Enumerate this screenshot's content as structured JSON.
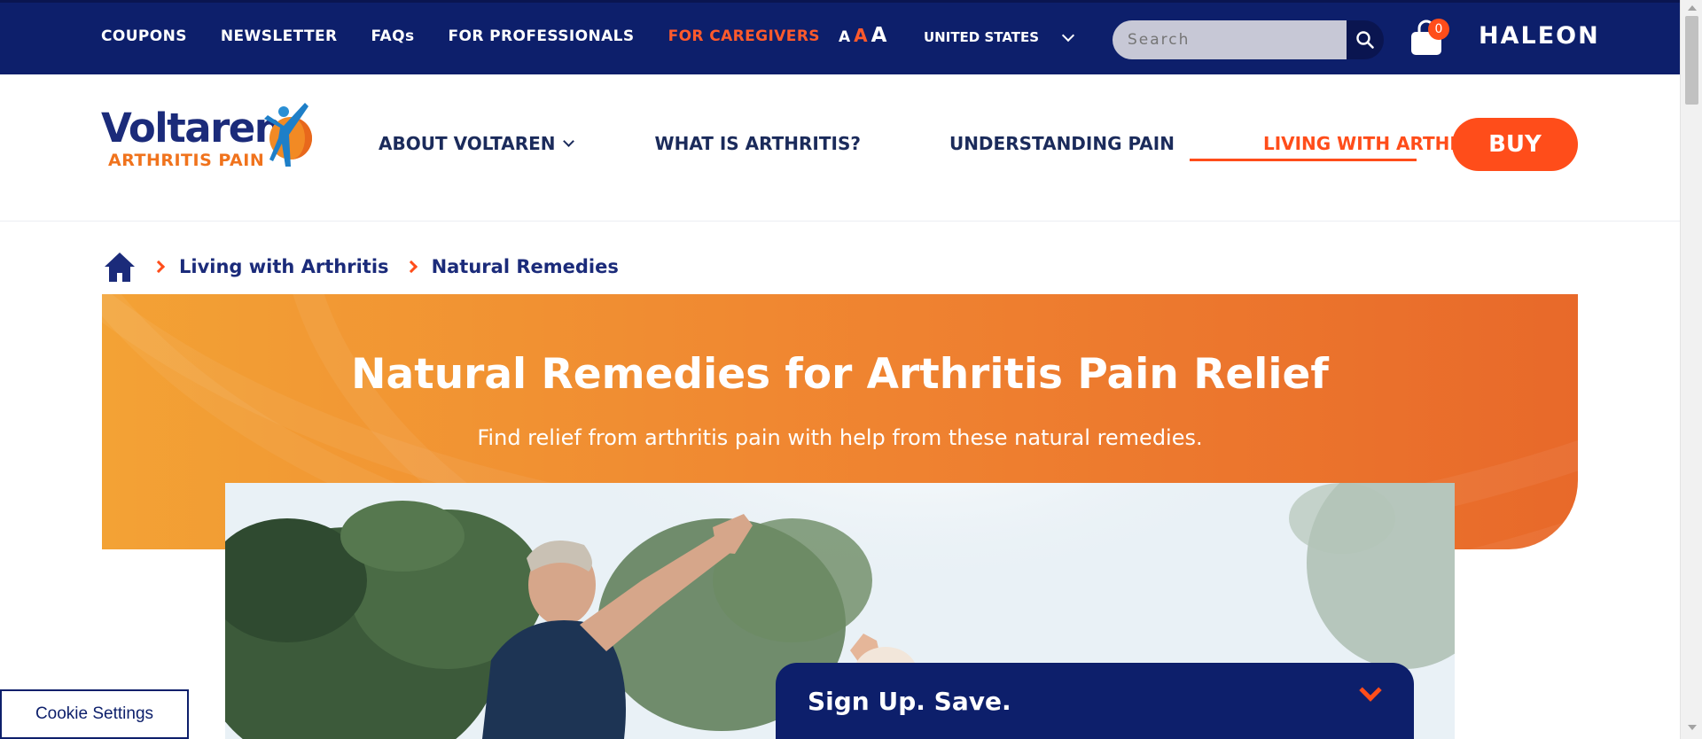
{
  "topbar": {
    "links": [
      "COUPONS",
      "NEWSLETTER",
      "FAQs",
      "FOR PROFESSIONALS",
      "FOR CAREGIVERS"
    ],
    "font_sizes": [
      "A",
      "A",
      "A"
    ],
    "country": "UNITED STATES",
    "search_placeholder": "Search",
    "cart_count": "0",
    "brand": "HALEON"
  },
  "header": {
    "logo_word": "Voltaren",
    "logo_sub": "ARTHRITIS PAIN",
    "nav": [
      "ABOUT VOLTAREN",
      "WHAT IS ARTHRITIS?",
      "UNDERSTANDING PAIN",
      "LIVING WITH ARTHRITIS"
    ],
    "buy": "BUY"
  },
  "breadcrumb": [
    "Living with Arthritis",
    "Natural Remedies"
  ],
  "hero": {
    "title": "Natural Remedies for Arthritis Pain Relief",
    "subtitle": "Find relief from arthritis pain with help from these natural remedies."
  },
  "signup": {
    "title": "Sign Up. Save."
  },
  "cookie": {
    "label": "Cookie Settings"
  },
  "colors": {
    "navy": "#0d1f6b",
    "accent": "#ff4d1a",
    "orange": "#ef8230"
  }
}
